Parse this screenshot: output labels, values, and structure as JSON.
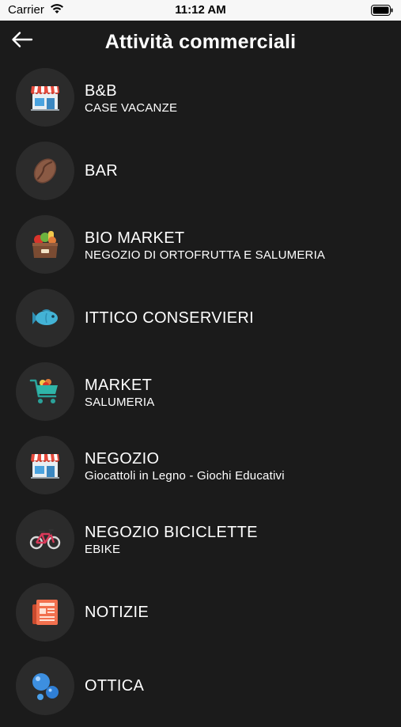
{
  "status_bar": {
    "carrier": "Carrier",
    "time": "11:12 AM"
  },
  "header": {
    "title": "Attività commerciali",
    "back_icon": "arrow-left-icon"
  },
  "categories": [
    {
      "title": "B&B",
      "subtitle": "CASE VACANZE",
      "icon": "store-icon"
    },
    {
      "title": "BAR",
      "subtitle": "",
      "icon": "coffee-bean-icon"
    },
    {
      "title": "BIO MARKET",
      "subtitle": "NEGOZIO DI ORTOFRUTTA E SALUMERIA",
      "icon": "produce-crate-icon"
    },
    {
      "title": "ITTICO CONSERVIERI",
      "subtitle": "",
      "icon": "fish-icon"
    },
    {
      "title": "MARKET",
      "subtitle": "SALUMERIA",
      "icon": "shopping-cart-icon"
    },
    {
      "title": "NEGOZIO",
      "subtitle": "Giocattoli in Legno - Giochi Educativi",
      "icon": "store-icon"
    },
    {
      "title": "NEGOZIO BICICLETTE",
      "subtitle": "EBIKE",
      "icon": "bicycle-icon"
    },
    {
      "title": "NOTIZIE",
      "subtitle": "",
      "icon": "newspaper-icon"
    },
    {
      "title": "OTTICA",
      "subtitle": "",
      "icon": "bubbles-icon"
    }
  ]
}
